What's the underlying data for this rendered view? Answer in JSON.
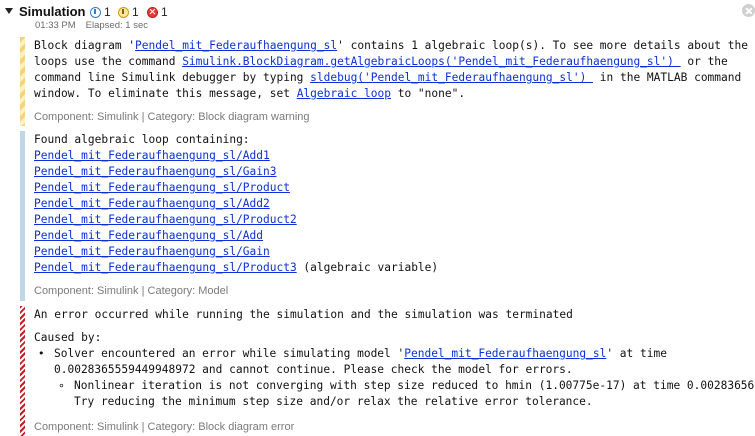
{
  "header": {
    "title": "Simulation",
    "info_count": "1",
    "warning_count": "1",
    "error_count": "1",
    "time": "01:33 PM",
    "elapsed": "Elapsed: 1 sec"
  },
  "warning": {
    "line1_a": "Block diagram '",
    "line1_link": "Pendel_mit_Federaufhaengung_sl",
    "line1_b": "' contains 1 algebraic loop(s). To see more details about the",
    "line2_a": "loops use the command ",
    "line2_link": "Simulink.BlockDiagram.getAlgebraicLoops('Pendel_mit_Federaufhaengung_sl') ",
    "line2_b": " or the",
    "line3_a": "command line Simulink debugger by typing ",
    "line3_link": "sldebug('Pendel_mit_Federaufhaengung_sl') ",
    "line3_b": " in the MATLAB command",
    "line4_a": "window. To eliminate this message, set ",
    "line4_link": "Algebraic loop",
    "line4_b": " to \"none\".",
    "component": "Component: Simulink | Category: Block diagram warning"
  },
  "loop": {
    "heading": "Found algebraic loop containing:",
    "blocks": [
      "Pendel_mit_Federaufhaengung_sl/Add1",
      "Pendel_mit_Federaufhaengung_sl/Gain3",
      "Pendel_mit_Federaufhaengung_sl/Product",
      "Pendel_mit_Federaufhaengung_sl/Add2",
      "Pendel_mit_Federaufhaengung_sl/Product2",
      "Pendel_mit_Federaufhaengung_sl/Add",
      "Pendel_mit_Federaufhaengung_sl/Gain",
      "Pendel_mit_Federaufhaengung_sl/Product3"
    ],
    "last_suffix": " (algebraic variable)",
    "component": "Component: Simulink | Category: Model"
  },
  "error": {
    "line1": "An error occurred while running the simulation and the simulation was terminated",
    "caused_by": "Caused by:",
    "b1_a": "Solver encountered an error while simulating model '",
    "b1_link": "Pendel_mit_Federaufhaengung_sl",
    "b1_b": "' at time",
    "b1_line2": "0.0028365559449948972 and cannot continue. Please check the model for errors.",
    "b2_line1": "Nonlinear iteration is not converging with step size reduced to hmin (1.00775e-17) at time 0.00283656.",
    "b2_line2": "Try reducing the minimum step size and/or relax the relative error tolerance.",
    "component": "Component: Simulink | Category: Block diagram error"
  },
  "colors": {
    "link": "#0b31d6",
    "warning_stripe": "#f7d27a",
    "info_stripe": "#bfd7ea",
    "error_stripe": "#c41e1e"
  }
}
